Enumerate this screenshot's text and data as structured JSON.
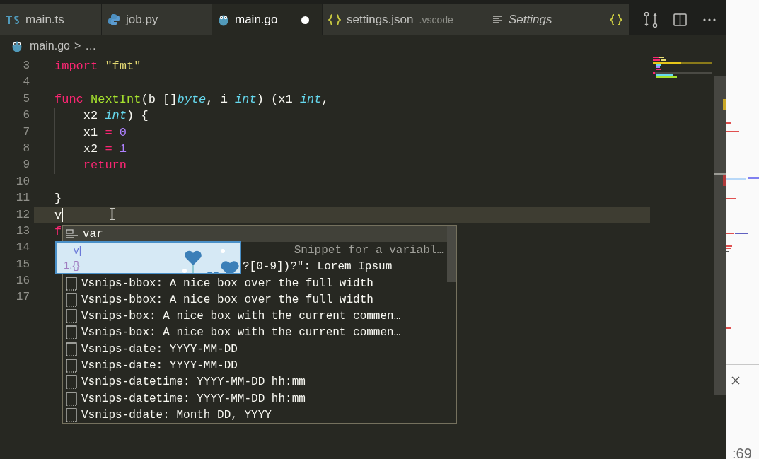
{
  "tabs": [
    {
      "kind": "ts",
      "label": "main.ts",
      "selected": false,
      "dirty": false
    },
    {
      "kind": "python",
      "label": "job.py",
      "selected": false,
      "dirty": false
    },
    {
      "kind": "go",
      "label": "main.go",
      "selected": true,
      "dirty": true
    },
    {
      "kind": "json",
      "label": "settings.json",
      "hint": ".vscode",
      "selected": false,
      "dirty": false
    },
    {
      "kind": "settings",
      "label": "Settings",
      "selected": false,
      "dirty": false
    },
    {
      "kind": "json",
      "selected": false,
      "dirty": false
    }
  ],
  "breadcrumb": {
    "file": "main.go",
    "separator": ">",
    "rest": "…"
  },
  "editor": {
    "lines": [
      {
        "number": "3",
        "tokens": [
          {
            "kind": "keyword",
            "text": "import"
          },
          {
            "kind": "string",
            "text": " \"fmt\""
          }
        ]
      },
      {
        "number": "4"
      },
      {
        "number": "5",
        "tokens": [
          {
            "kind": "keyword",
            "text": "func"
          },
          {
            "kind": "func",
            "text": " NextInt"
          },
          {
            "kind": "plain",
            "text": "(b []"
          },
          {
            "kind": "type",
            "text": "byte"
          },
          {
            "kind": "plain",
            "text": ", i "
          },
          {
            "kind": "type",
            "text": "int"
          },
          {
            "kind": "plain",
            "text": ") (x1 "
          },
          {
            "kind": "type",
            "text": "int"
          },
          {
            "kind": "plain",
            "text": ","
          }
        ]
      },
      {
        "number": "6",
        "tokens": [
          {
            "kind": "plain",
            "text": "    x2 "
          },
          {
            "kind": "type",
            "text": "int"
          },
          {
            "kind": "plain",
            "text": ") {"
          }
        ]
      },
      {
        "number": "7",
        "tokens": [
          {
            "kind": "plain",
            "text": "    x1 "
          },
          {
            "kind": "keyword",
            "text": "="
          },
          {
            "kind": "number",
            "text": " 0"
          }
        ]
      },
      {
        "number": "8",
        "tokens": [
          {
            "kind": "plain",
            "text": "    x2 "
          },
          {
            "kind": "keyword",
            "text": "="
          },
          {
            "kind": "number",
            "text": " 1"
          }
        ]
      },
      {
        "number": "9",
        "tokens": [
          {
            "kind": "keyword",
            "text": "    return"
          }
        ]
      },
      {
        "number": "10"
      },
      {
        "number": "11",
        "tokens": [
          {
            "kind": "plain",
            "text": "}"
          }
        ]
      },
      {
        "number": "12",
        "current": true,
        "tokens": [
          {
            "kind": "plain",
            "text": "v"
          }
        ]
      },
      {
        "number": "13",
        "tokens": [
          {
            "kind": "keyword",
            "text": "f"
          }
        ]
      },
      {
        "number": "14"
      },
      {
        "number": "15"
      },
      {
        "number": "16"
      },
      {
        "number": "17"
      }
    ]
  },
  "suggestions": [
    {
      "kind": "keyword",
      "label": "var",
      "selected": true
    },
    {
      "kind": "detail",
      "label": "Snippet for a variabl…",
      "selected": false
    },
    {
      "kind": "partial",
      "label": "?[0-9])?\": Lorem Ipsum",
      "selected": false
    },
    {
      "kind": "snippet",
      "label": "Vsnips-bbox: A nice box over the full width",
      "selected": false
    },
    {
      "kind": "snippet",
      "label": "Vsnips-bbox: A nice box over the full width",
      "selected": false
    },
    {
      "kind": "snippet",
      "label": "Vsnips-box: A nice box with the current commen…",
      "selected": false
    },
    {
      "kind": "snippet",
      "label": "Vsnips-box: A nice box with the current commen…",
      "selected": false
    },
    {
      "kind": "snippet",
      "label": "Vsnips-date: YYYY-MM-DD",
      "selected": false
    },
    {
      "kind": "snippet",
      "label": "Vsnips-date: YYYY-MM-DD",
      "selected": false
    },
    {
      "kind": "snippet",
      "label": "Vsnips-datetime: YYYY-MM-DD hh:mm",
      "selected": false
    },
    {
      "kind": "snippet",
      "label": "Vsnips-datetime: YYYY-MM-DD hh:mm",
      "selected": false
    },
    {
      "kind": "snippet",
      "label": "Vsnips-ddate: Month DD, YYYY",
      "selected": false
    }
  ],
  "overlay": {
    "lines": [
      "v|",
      "1.{}"
    ]
  },
  "side_panel": {
    "footer": ":69"
  }
}
